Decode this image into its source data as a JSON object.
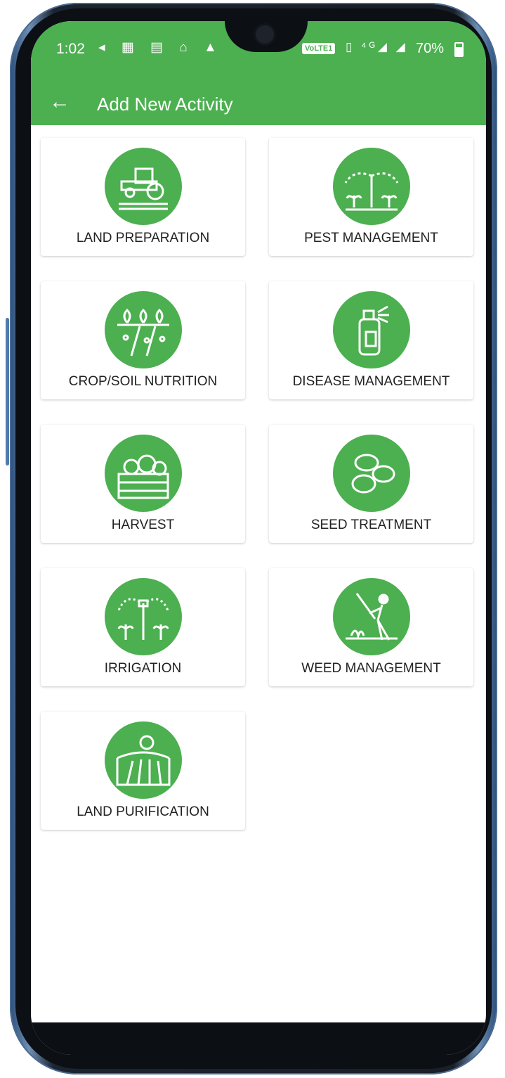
{
  "status_bar": {
    "time": "1:02",
    "left_icons": "◂ ▦ ▤ ⌂ ▲",
    "volte": "VoLTE1",
    "right_icons": "▯ ⁴ᴳ◢ ◢",
    "battery": "70%"
  },
  "app_bar": {
    "back_icon": "←",
    "title": "Add New Activity"
  },
  "activities": [
    {
      "label": "LAND PREPARATION",
      "icon": "tractor-icon"
    },
    {
      "label": "PEST MANAGEMENT",
      "icon": "sprinkler-plants-icon"
    },
    {
      "label": "CROP/SOIL NUTRITION",
      "icon": "crop-rows-icon"
    },
    {
      "label": "DISEASE MANAGEMENT",
      "icon": "spray-bottle-icon"
    },
    {
      "label": "HARVEST",
      "icon": "vegetable-crate-icon"
    },
    {
      "label": "SEED TREATMENT",
      "icon": "seeds-icon"
    },
    {
      "label": "IRRIGATION",
      "icon": "irrigation-sprinkler-icon"
    },
    {
      "label": "WEED MANAGEMENT",
      "icon": "farmer-hoe-icon"
    },
    {
      "label": "LAND PURIFICATION",
      "icon": "sun-field-icon"
    }
  ],
  "colors": {
    "primary": "#4caf50",
    "card_bg": "#ffffff",
    "label_text": "#222222"
  }
}
